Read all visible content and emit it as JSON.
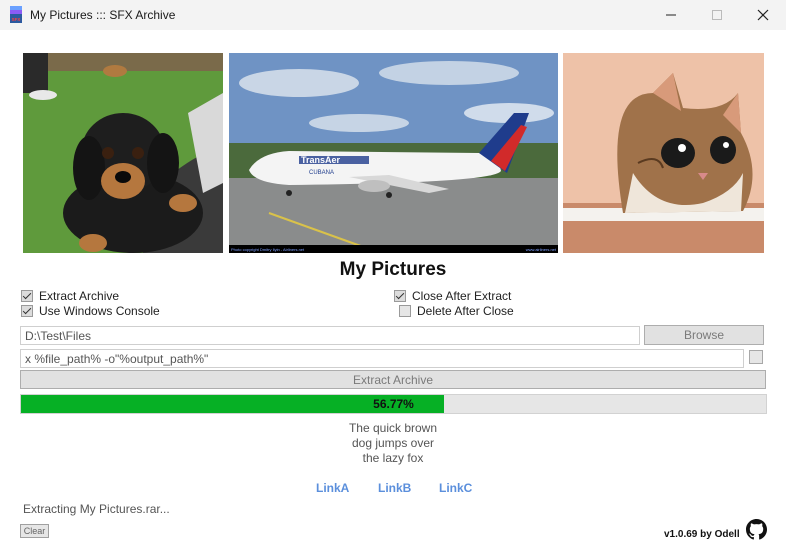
{
  "window": {
    "title": "My Pictures ::: SFX Archive",
    "icon": "sfx-archive-icon"
  },
  "heading": "My Pictures",
  "images": {
    "dog": "dachshund-puppy-photo",
    "plane": "transaer-cubana-airplane-photo",
    "plane_caption_left": "Photo copyright Dmitry Ilyin - Airliners.net",
    "plane_caption_right": "www.airliners.net",
    "cat": "kitten-photo"
  },
  "options": {
    "extract_archive": {
      "label": "Extract Archive",
      "checked": true
    },
    "use_console": {
      "label": "Use Windows Console",
      "checked": true
    },
    "close_after": {
      "label": "Close After Extract",
      "checked": true
    },
    "delete_after": {
      "label": "Delete After Close",
      "checked": false
    }
  },
  "output_path": "D:\\Test\\Files",
  "browse_label": "Browse",
  "command": "x %file_path% -o\"%output_path%\"",
  "extract_label": "Extract Archive",
  "progress": {
    "value": 0.5677,
    "label": "56.77%",
    "color": "#06b025"
  },
  "description": [
    "The quick brown",
    "dog jumps over",
    "the lazy fox"
  ],
  "links": [
    "LinkA",
    "LinkB",
    "LinkC"
  ],
  "status": "Extracting My Pictures.rar...",
  "clear_label": "Clear",
  "version": "v1.0.69 by Odell",
  "colors": {
    "link": "#5b8fdc",
    "progress": "#06b025"
  }
}
